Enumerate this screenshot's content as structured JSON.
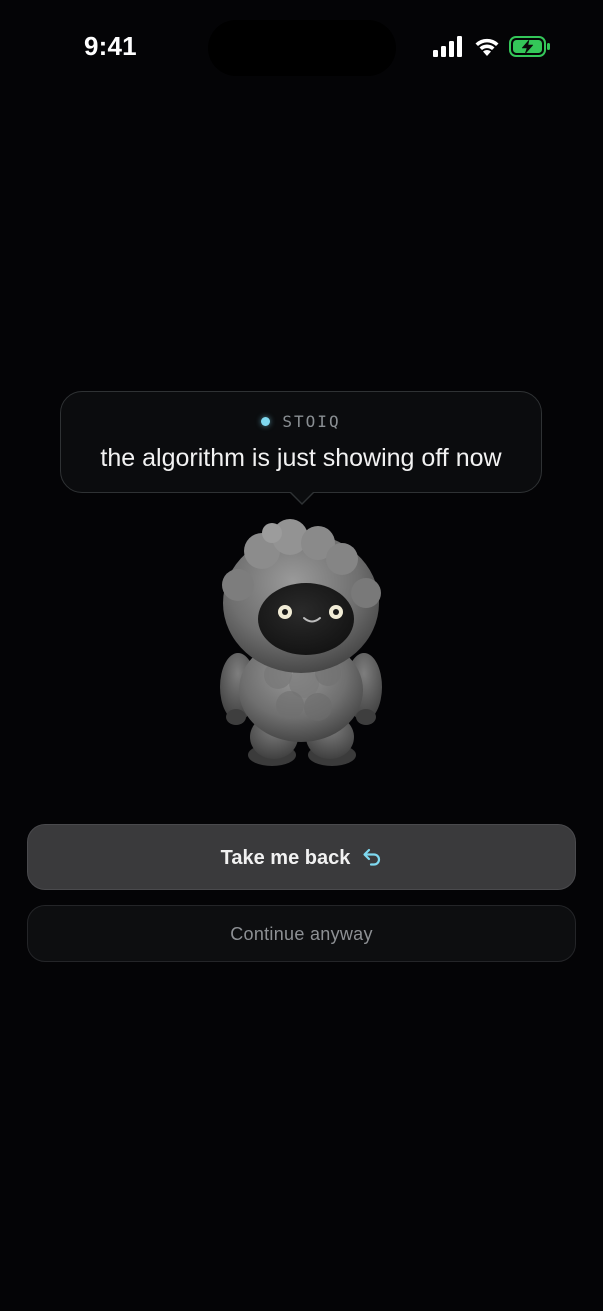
{
  "status_bar": {
    "time": "9:41",
    "icons": [
      "cellular-signal-icon",
      "wifi-icon",
      "battery-charging-icon"
    ],
    "battery_color": "#34c759"
  },
  "bubble": {
    "brand": "STOIQ",
    "message": "the algorithm is just showing off now",
    "accent_color": "#7fd9f0"
  },
  "mascot": {
    "icon": "fluffy-yeti-mascot"
  },
  "actions": {
    "primary_label": "Take me back",
    "primary_icon": "undo-arrow-icon",
    "secondary_label": "Continue anyway"
  }
}
